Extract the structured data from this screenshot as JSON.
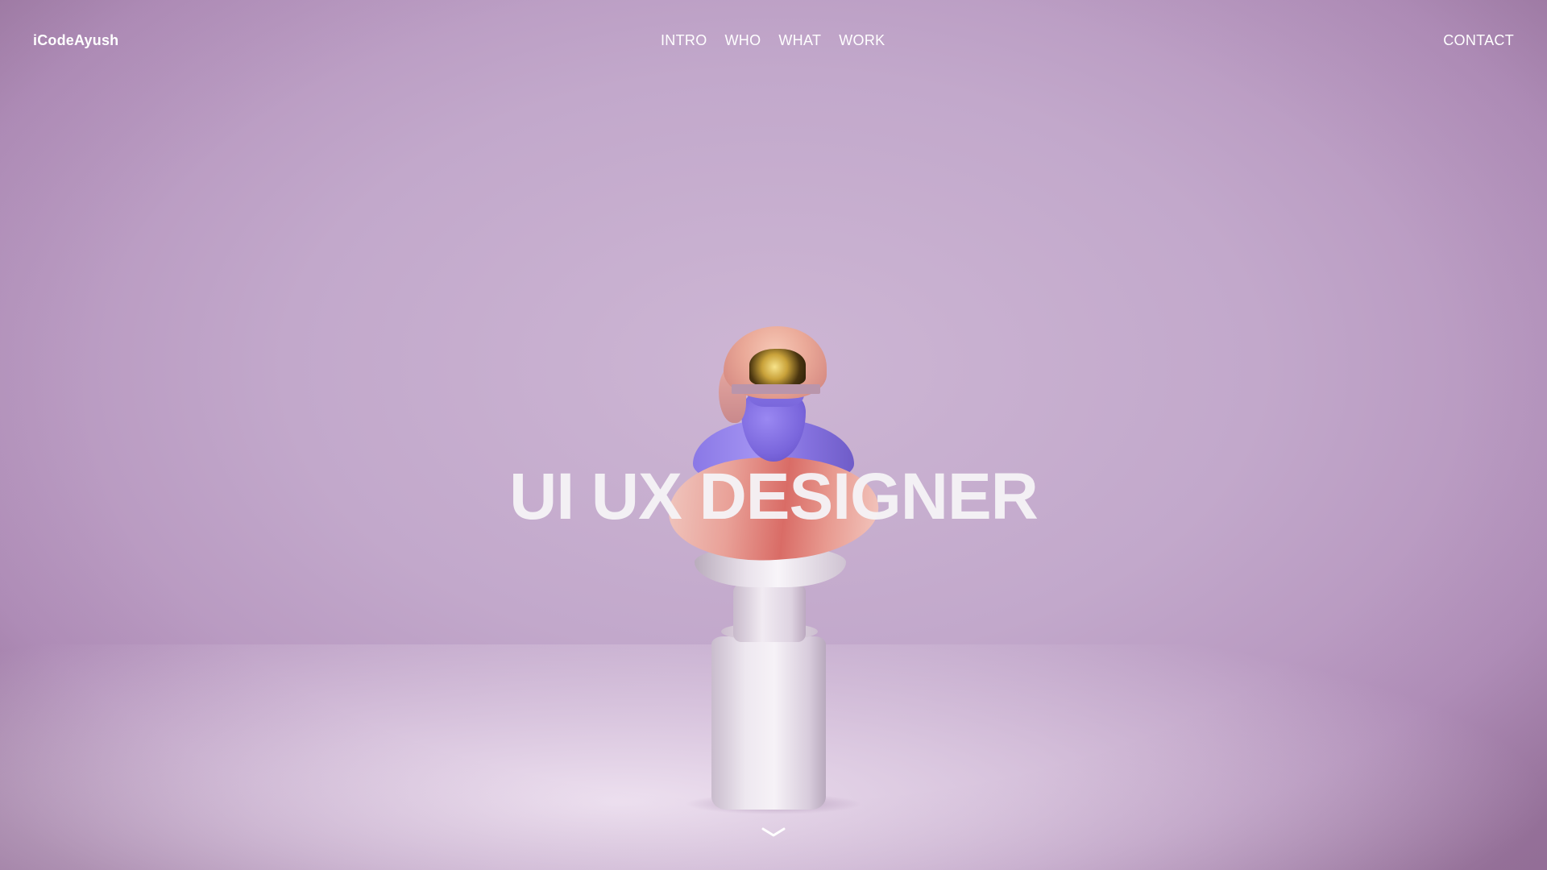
{
  "header": {
    "logo": "iCodeAyush",
    "nav": [
      {
        "label": "INTRO"
      },
      {
        "label": "WHO"
      },
      {
        "label": "WHAT"
      },
      {
        "label": "WORK"
      }
    ],
    "contact_label": "CONTACT"
  },
  "hero": {
    "headline": "UI UX DESIGNER",
    "image": "sculpture-bust-on-pedestal",
    "scroll_icon": "chevron-down-icon"
  },
  "colors": {
    "background": "#c5aecd",
    "text": "#ffffff",
    "band": "#e08a84",
    "bust": "#8a78e6",
    "pedestal": "#eee8f0"
  }
}
